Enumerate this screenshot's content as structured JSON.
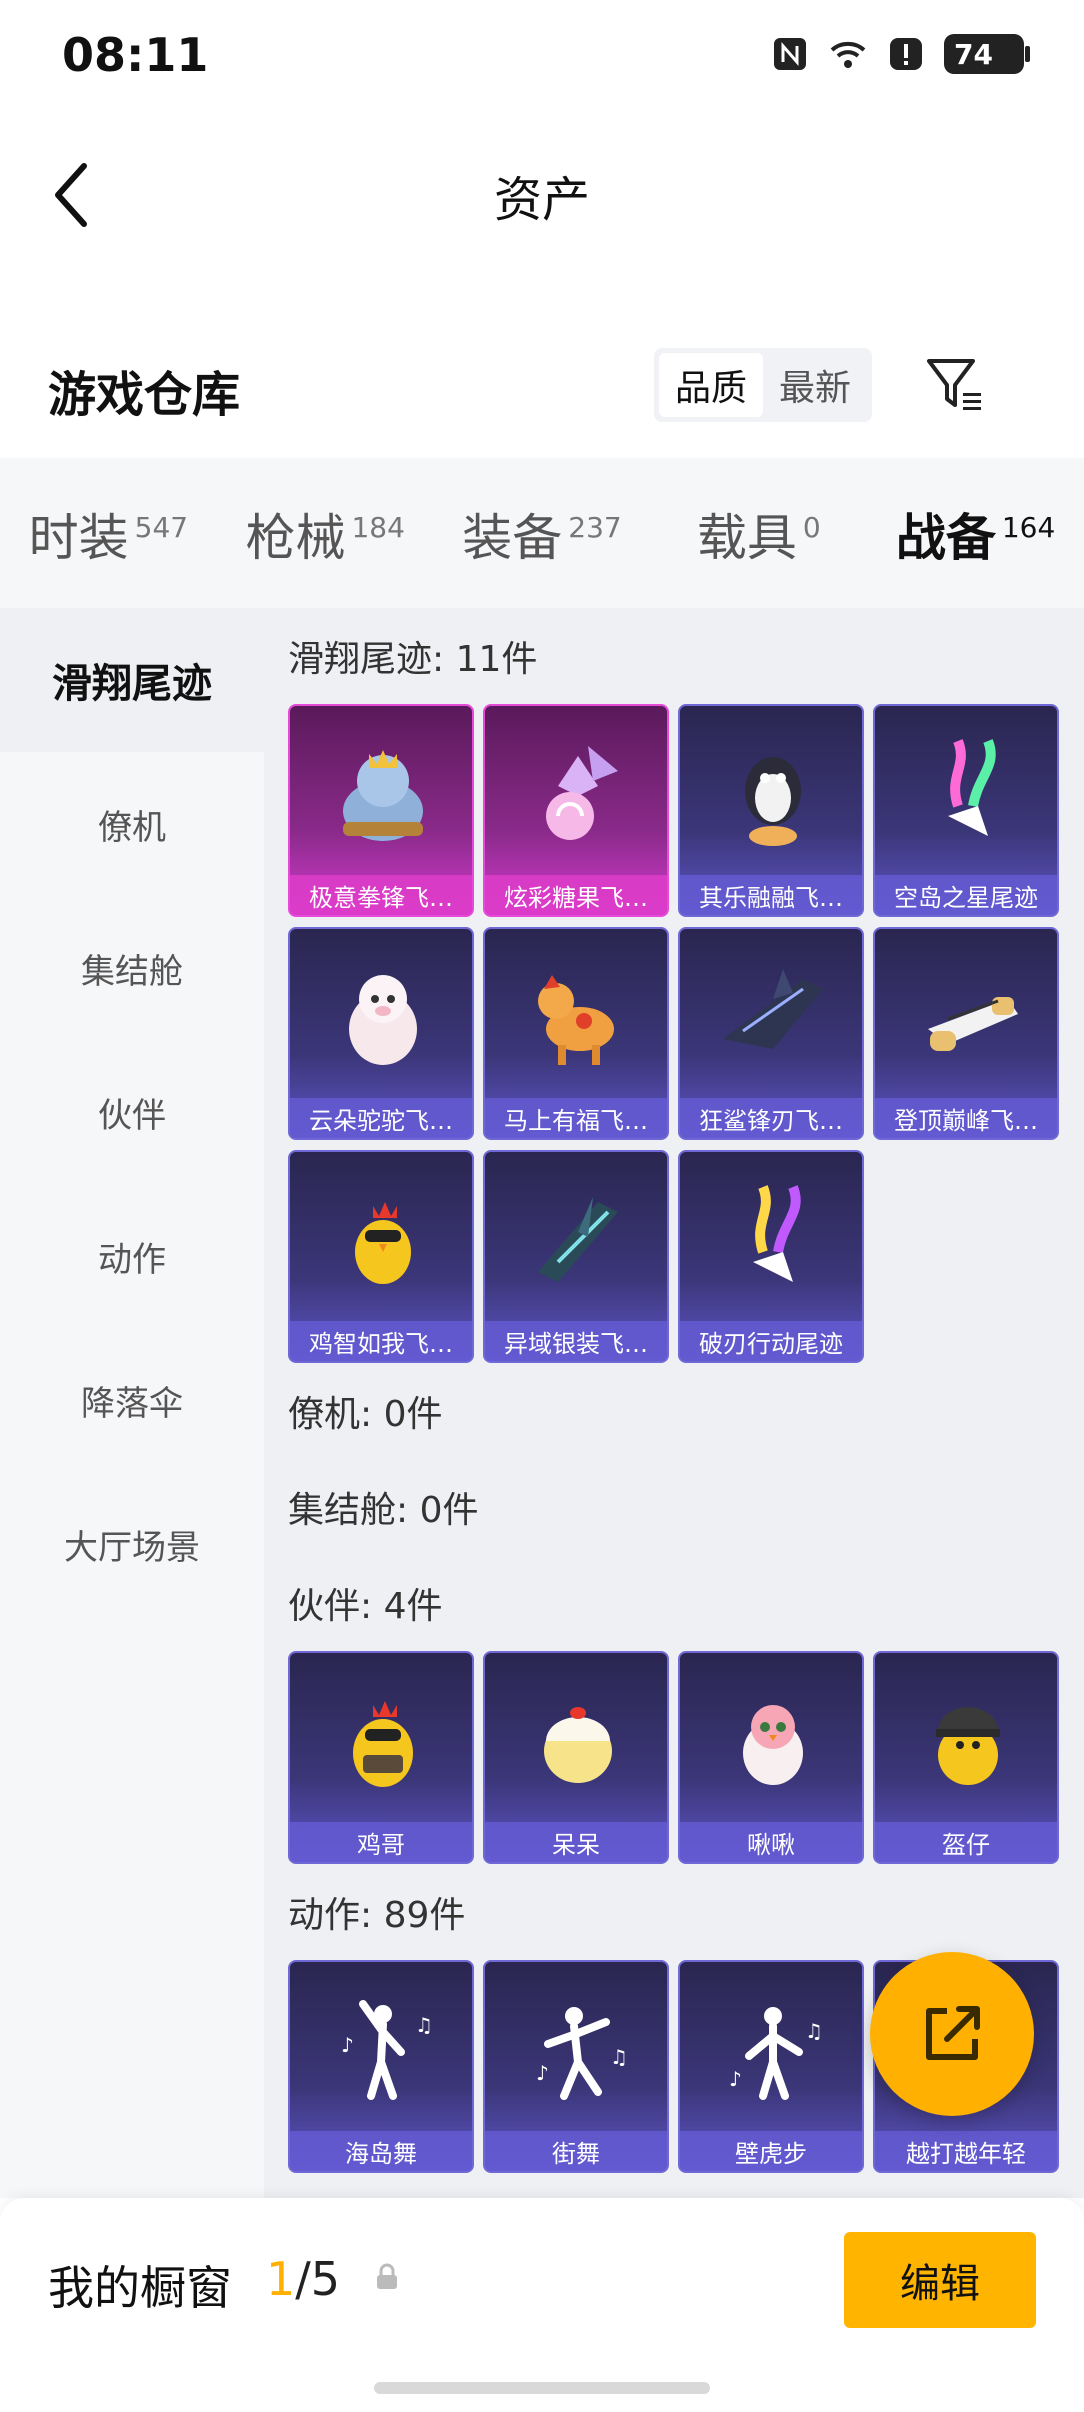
{
  "status_bar": {
    "time": "08:11",
    "battery": "74"
  },
  "header": {
    "title": "资产"
  },
  "section": {
    "title": "游戏仓库",
    "sort_options": [
      "品质",
      "最新"
    ]
  },
  "tabs": [
    {
      "label": "时装",
      "count": "547"
    },
    {
      "label": "枪械",
      "count": "184"
    },
    {
      "label": "装备",
      "count": "237"
    },
    {
      "label": "载具",
      "count": "0"
    },
    {
      "label": "战备",
      "count": "164"
    }
  ],
  "sidebar": [
    {
      "label": "滑翔尾迹"
    },
    {
      "label": "僚机"
    },
    {
      "label": "集结舱"
    },
    {
      "label": "伙伴"
    },
    {
      "label": "动作"
    },
    {
      "label": "降落伞"
    },
    {
      "label": "大厅场景"
    }
  ],
  "groups": {
    "trails": {
      "title": "滑翔尾迹: 11件",
      "items": [
        "极意拳锋飞…",
        "炫彩糖果飞…",
        "其乐融融飞…",
        "空岛之星尾迹",
        "云朵驼驼飞…",
        "马上有福飞…",
        "狂鲨锋刃飞…",
        "登顶巅峰飞…",
        "鸡智如我飞…",
        "异域银装飞…",
        "破刃行动尾迹"
      ]
    },
    "wingman": {
      "title": "僚机: 0件"
    },
    "pod": {
      "title": "集结舱: 0件"
    },
    "partners": {
      "title": "伙伴: 4件",
      "items": [
        "鸡哥",
        "呆呆",
        "啾啾",
        "盔仔"
      ]
    },
    "emotes": {
      "title": "动作: 89件",
      "items": [
        "海岛舞",
        "街舞",
        "壁虎步",
        "越打越年轻"
      ]
    }
  },
  "bottom": {
    "title": "我的橱窗",
    "current": "1",
    "total": "/5",
    "edit_label": "编辑"
  }
}
